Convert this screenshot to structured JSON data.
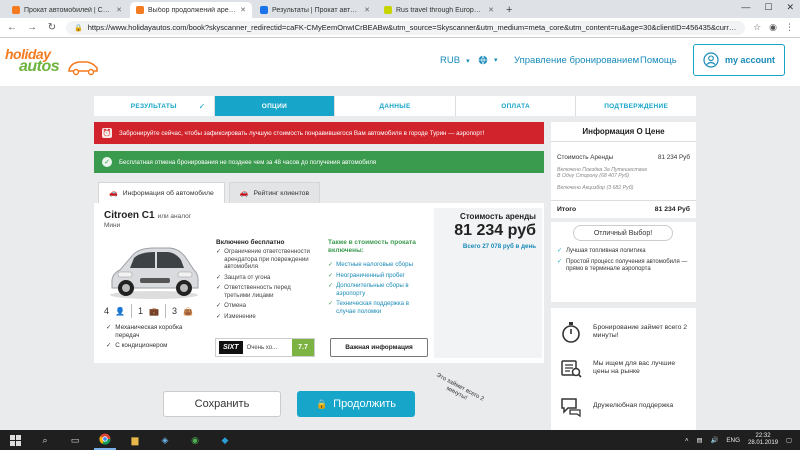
{
  "browser": {
    "tabs": [
      {
        "title": "Прокат автомобилей | Сравне...",
        "color": "#f47b20",
        "active": false
      },
      {
        "title": "Выбор продолжений аренды в...",
        "color": "#f47b20",
        "active": true
      },
      {
        "title": "Результаты | Прокат автомоби...",
        "color": "#1a73e8",
        "active": false
      },
      {
        "title": "Rus travel through Europe | Fb...",
        "color": "#c6d400",
        "active": false
      }
    ],
    "new_tab": "+",
    "url": "https://www.holidayautos.com/book?skyscanner_redirectid=caFK-CMyEemOnwICrBEABw&utm_source=Skyscanner&utm_medium=meta_core&utm_content=ru&age=30&clientID=456435&curr=RUB&ln=..."
  },
  "header": {
    "logo_top": "holiday",
    "logo_bottom": "autos",
    "currency": "RUB",
    "manage": "Управление бронированием",
    "help": "Помощь",
    "account": "my account"
  },
  "steps": [
    {
      "label": "РЕЗУЛЬТАТЫ",
      "state": "done"
    },
    {
      "label": "ОПЦИИ",
      "state": "current"
    },
    {
      "label": "ДАННЫЕ",
      "state": "todo"
    },
    {
      "label": "ОПЛАТА",
      "state": "todo"
    },
    {
      "label": "ПОДТВЕРЖДЕНИЕ",
      "state": "todo"
    }
  ],
  "alerts": {
    "red": "Забронируйте сейчас, чтобы зафиксировать лучшую стоимость понравившегося Вам автомобиля в городе Турин — аэропорт!",
    "green": "Бесплатная отмена бронирования не позднее чем за 48 часов до получения автомобиля"
  },
  "panel_tabs": {
    "car_info": "Информация об автомобиле",
    "reviews": "Рейтинг клиентов"
  },
  "car": {
    "name": "Citroen C1",
    "or_similar": "или аналог",
    "class": "Мини",
    "seats": "4",
    "bags_large": "1",
    "bags_small": "3",
    "features": [
      "Механическая коробка передач",
      "С кондиционером"
    ],
    "included_title": "Включено бесплатно",
    "included": [
      "Ограничение ответственности арендатора при повреждении автомобиля",
      "Защита от угона",
      "Ответственность перед третьими лицами",
      "Отмена",
      "Изменение"
    ],
    "also_title": "Также в стоимость проката включены:",
    "also": [
      "Местные налоговые сборы",
      "Неограниченный пробег",
      "Дополнительные сборы в аэропорту",
      "Техническая поддержка в случае поломки"
    ],
    "supplier": "SIXT",
    "rating_text": "Очень хо...",
    "rating_score": "7.7",
    "info_button": "Важная информация",
    "price_label": "Стоимость аренды",
    "price": "81 234 руб",
    "price_total": "Всего 27 078 руб в день"
  },
  "actions": {
    "save": "Сохранить",
    "continue": "Продолжить",
    "note": "Это займет всего 2 минуты!"
  },
  "price_info": {
    "title": "Информация О Цене",
    "rent_label": "Стоимость Аренды",
    "rent_value": "81 234 Руб",
    "small1": "Включено Поездка За Путешествие В Одну Сторону (68 407 Руб)",
    "small2": "Включено Акцизбор (3 682 Руб)",
    "total_label": "Итого",
    "total_value": "81 234 Руб"
  },
  "choice": {
    "title": "Отличный Выбор!",
    "items": [
      "Лучшая топливная политика",
      "Простой процесс получения автомобиля — прямо в терминале аэропорта"
    ]
  },
  "why": [
    {
      "icon": "stopwatch-icon",
      "text": "Бронирование займет всего 2 минуты!"
    },
    {
      "icon": "search-prices-icon",
      "text": "Мы ищем для вас лучшие цены на рынке"
    },
    {
      "icon": "support-chat-icon",
      "text": "Дружелюбная поддержка"
    }
  ],
  "taskbar": {
    "lang": "ENG",
    "time": "22:32",
    "date": "28.01.2019"
  },
  "colors": {
    "brand_blue": "#17a6c9",
    "alert_red": "#d0232b",
    "alert_green": "#3a9a4e",
    "logo_orange": "#f47b20",
    "logo_green": "#6db33f"
  }
}
